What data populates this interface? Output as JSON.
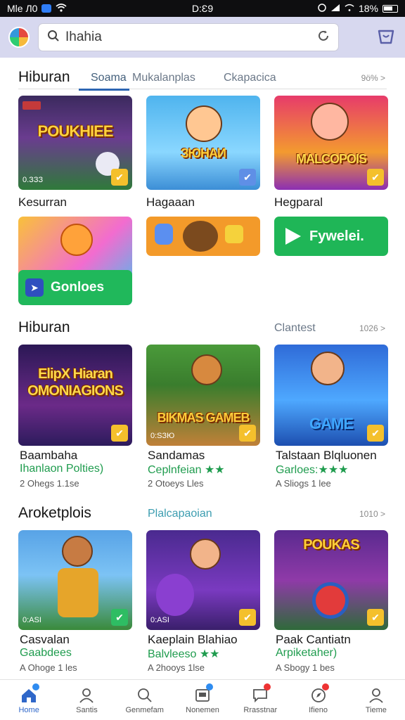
{
  "status_bar": {
    "left": "Mle Л0",
    "time": "D:Ɛ9",
    "right": "18%"
  },
  "search": {
    "value": "Ihahia"
  },
  "sections": [
    {
      "title": "Hiburan",
      "tabs": [
        "Soama",
        "Mukalanplas",
        "Ckapacica"
      ],
      "more": "9ö% >",
      "cards": [
        {
          "art": "POUKHIEE",
          "corner_label": "0.ЗЗЗ"
        },
        {
          "art": "ЗЮНАИ",
          "corner_label": ""
        },
        {
          "art": "MALCOPOIS",
          "corner_label": ""
        }
      ],
      "names": [
        "Kesurran",
        "Hagaaan",
        "Hegparal"
      ],
      "promo": {
        "label": "Gonloes",
        "cta": "Fywelei."
      }
    },
    {
      "title": "Hiburan",
      "tab": "Clantest",
      "more": "1026 >",
      "cards": [
        {
          "art": "ElipX Hiaran OMONIAGIONS",
          "corner_label": ""
        },
        {
          "art": "BIKMAS GAMEB",
          "corner_label": "0:SЗЮ"
        },
        {
          "art": "GAME",
          "corner_label": ""
        }
      ],
      "games": [
        {
          "name": "Baambaha",
          "sub": "Ihanlaon Polties)",
          "meta": "2 Ohegs 1.1se"
        },
        {
          "name": "Sandamas",
          "sub": "Ceplnfeian ★★",
          "meta": "2 Otoeys Lles"
        },
        {
          "name": "Talstaan Blqluonen",
          "sub": "Garloes:★★★",
          "meta": "A Sliogs 1 lee"
        }
      ]
    },
    {
      "title": "Aroketplois",
      "tab": "Plalcapaoian",
      "more": "1010 >",
      "cards": [
        {
          "art": "",
          "corner_label": "0:ASI"
        },
        {
          "art": "",
          "corner_label": "0:ASI"
        },
        {
          "art": "POUKAS",
          "corner_label": ""
        }
      ],
      "games": [
        {
          "name": "Casvalan",
          "sub": "Gaabdees",
          "meta": "A Ohoge 1 les"
        },
        {
          "name": "Kaeplain Blahiao",
          "sub": "Balvleeso ★★",
          "meta": "A 2hooys 1lse"
        },
        {
          "name": "Paak Cantiatn",
          "sub": "Arpiketaher)",
          "meta": "A Sbogy 1 bes"
        }
      ]
    }
  ],
  "bottom_nav": [
    "Home",
    "Santis",
    "Genmefam",
    "Nonemen",
    "Rrasstnar",
    "Ifieno",
    "Tieme"
  ],
  "colors": {
    "accent": "#2f67c9",
    "header_bg": "#d7d8ef",
    "green": "#1f9c4e"
  }
}
